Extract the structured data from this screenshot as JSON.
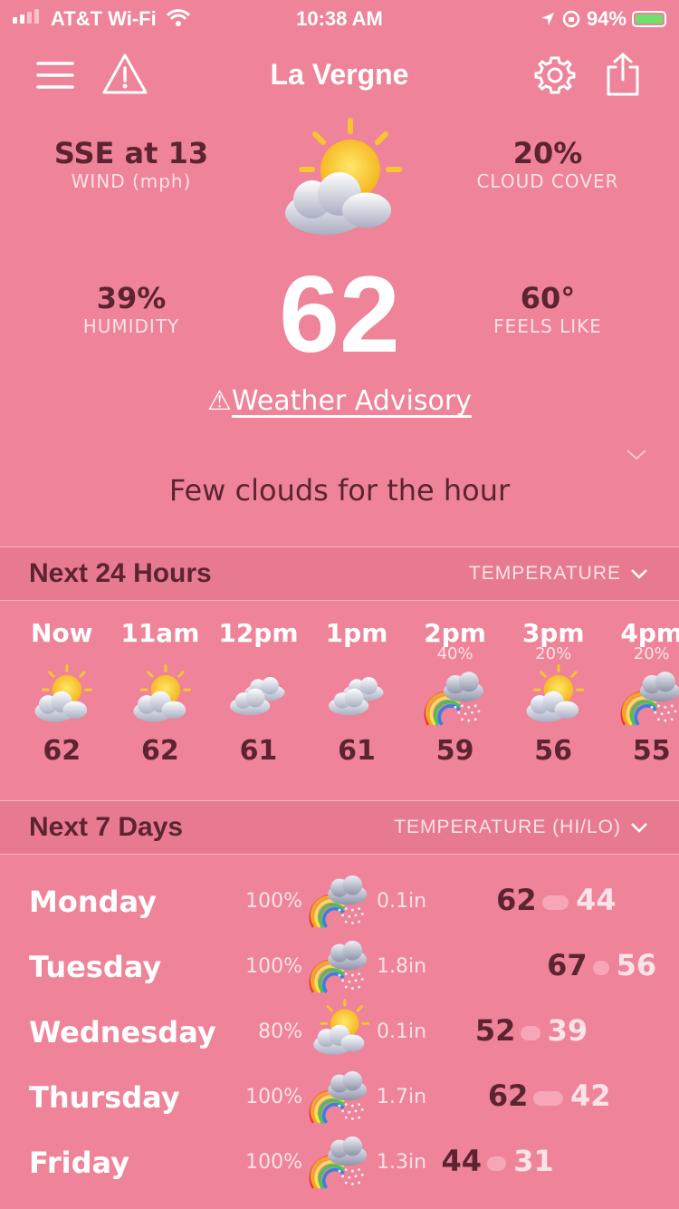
{
  "status_bar": {
    "carrier": "AT&T Wi-Fi",
    "time": "10:38 AM",
    "battery": "94%"
  },
  "header": {
    "city": "La Vergne",
    "icons": [
      "menu-icon",
      "warning-icon",
      "gear-icon",
      "share-icon"
    ]
  },
  "current": {
    "wind_value": "SSE at 13",
    "wind_label": "WIND (mph)",
    "cloud_value": "20%",
    "cloud_label": "CLOUD COVER",
    "humidity_value": "39%",
    "humidity_label": "HUMIDITY",
    "feels_value": "60°",
    "feels_label": "FEELS LIKE",
    "temperature": "62",
    "advisory_icon": "⚠",
    "advisory": "Weather Advisory",
    "summary": "Few clouds for the hour"
  },
  "hourly": {
    "title": "Next 24 Hours",
    "selector": "TEMPERATURE",
    "hours": [
      {
        "label": "Now",
        "pct": "",
        "temp": "62",
        "icon": "sun-cloud"
      },
      {
        "label": "11am",
        "pct": "",
        "temp": "62",
        "icon": "sun-cloud"
      },
      {
        "label": "12pm",
        "pct": "",
        "temp": "61",
        "icon": "clouds"
      },
      {
        "label": "1pm",
        "pct": "",
        "temp": "61",
        "icon": "clouds"
      },
      {
        "label": "2pm",
        "pct": "40%",
        "temp": "59",
        "icon": "rain-rainbow"
      },
      {
        "label": "3pm",
        "pct": "20%",
        "temp": "56",
        "icon": "sun-cloud"
      },
      {
        "label": "4pm",
        "pct": "20%",
        "temp": "55",
        "icon": "rain-rainbow"
      }
    ]
  },
  "daily": {
    "title": "Next 7 Days",
    "selector": "TEMPERATURE (HI/LO)",
    "range": [
      25,
      70
    ],
    "days": [
      {
        "name": "Monday",
        "prob": "100%",
        "amount": "0.1in",
        "hi": "62",
        "lo": "44",
        "icon": "rain-rainbow"
      },
      {
        "name": "Tuesday",
        "prob": "100%",
        "amount": "1.8in",
        "hi": "67",
        "lo": "56",
        "icon": "rain-rainbow"
      },
      {
        "name": "Wednesday",
        "prob": "80%",
        "amount": "0.1in",
        "hi": "52",
        "lo": "39",
        "icon": "sun-cloud"
      },
      {
        "name": "Thursday",
        "prob": "100%",
        "amount": "1.7in",
        "hi": "62",
        "lo": "42",
        "icon": "rain-rainbow"
      },
      {
        "name": "Friday",
        "prob": "100%",
        "amount": "1.3in",
        "hi": "44",
        "lo": "31",
        "icon": "rain-rainbow"
      }
    ]
  }
}
